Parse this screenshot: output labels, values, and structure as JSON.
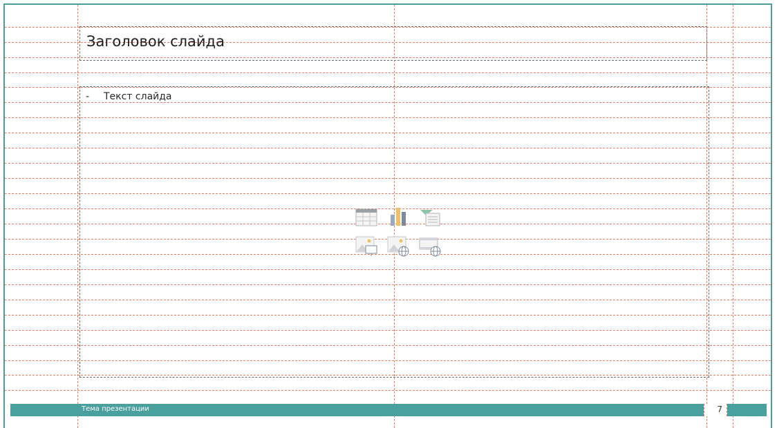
{
  "slide": {
    "title": "Заголовок слайда",
    "body_bullet_marker": "-",
    "body_text": "Текст слайда",
    "footer_text": "Тема презентации",
    "slide_number": "7"
  },
  "content_placeholder_icons": [
    "insert-table-icon",
    "insert-chart-icon",
    "insert-smartart-icon",
    "insert-picture-icon",
    "insert-online-picture-icon",
    "insert-video-icon"
  ],
  "colors": {
    "accent": "#4aa09e",
    "guides": "#e57c63",
    "frame_border": "#4a9d9b"
  }
}
